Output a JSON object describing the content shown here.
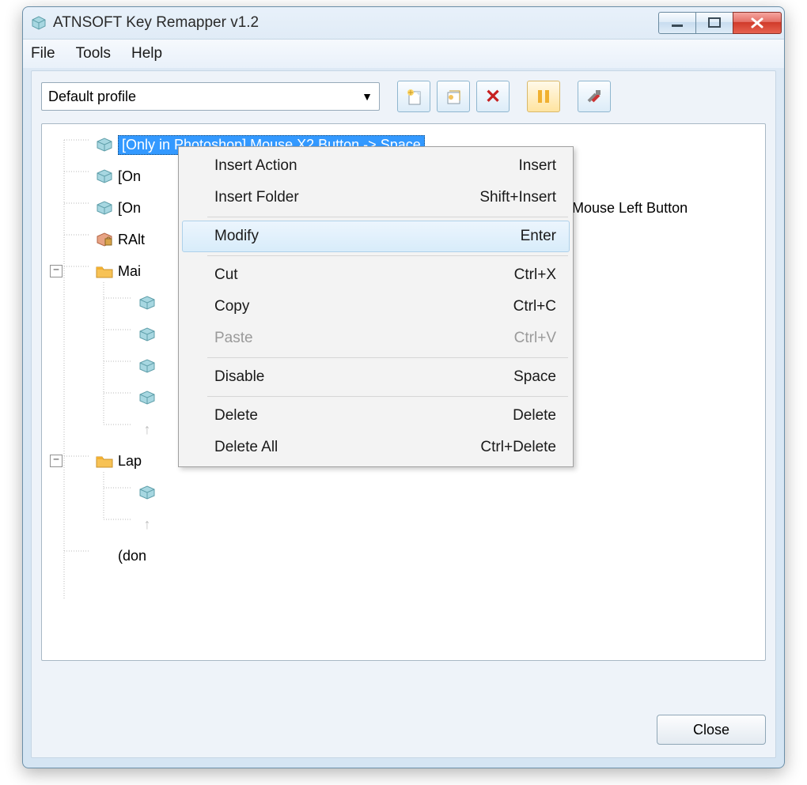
{
  "title": "ATNSOFT Key Remapper v1.2",
  "menu": {
    "file": "File",
    "tools": "Tools",
    "help": "Help"
  },
  "profile": "Default profile",
  "toolbar_icons": {
    "new": "new-action-icon",
    "edit": "edit-action-icon",
    "delete": "delete-icon",
    "pause": "pause-icon",
    "settings": "tools-icon"
  },
  "tree": {
    "n0": "[Only in Photoshop] Mouse X2 Button -> Space",
    "n1": "[On",
    "n2": "[On",
    "n2_suffix": "Mouse Left Button",
    "n3": "RAlt",
    "folder1": "Mai",
    "folder2": "Lap",
    "last": "(don"
  },
  "context": [
    {
      "label": "Insert Action",
      "shortcut": "Insert"
    },
    {
      "label": "Insert Folder",
      "shortcut": "Shift+Insert"
    },
    "sep",
    {
      "label": "Modify",
      "shortcut": "Enter",
      "hover": true
    },
    "sep",
    {
      "label": "Cut",
      "shortcut": "Ctrl+X"
    },
    {
      "label": "Copy",
      "shortcut": "Ctrl+C"
    },
    {
      "label": "Paste",
      "shortcut": "Ctrl+V",
      "disabled": true
    },
    "sep",
    {
      "label": "Disable",
      "shortcut": "Space"
    },
    "sep",
    {
      "label": "Delete",
      "shortcut": "Delete"
    },
    {
      "label": "Delete All",
      "shortcut": "Ctrl+Delete"
    }
  ],
  "close": "Close"
}
